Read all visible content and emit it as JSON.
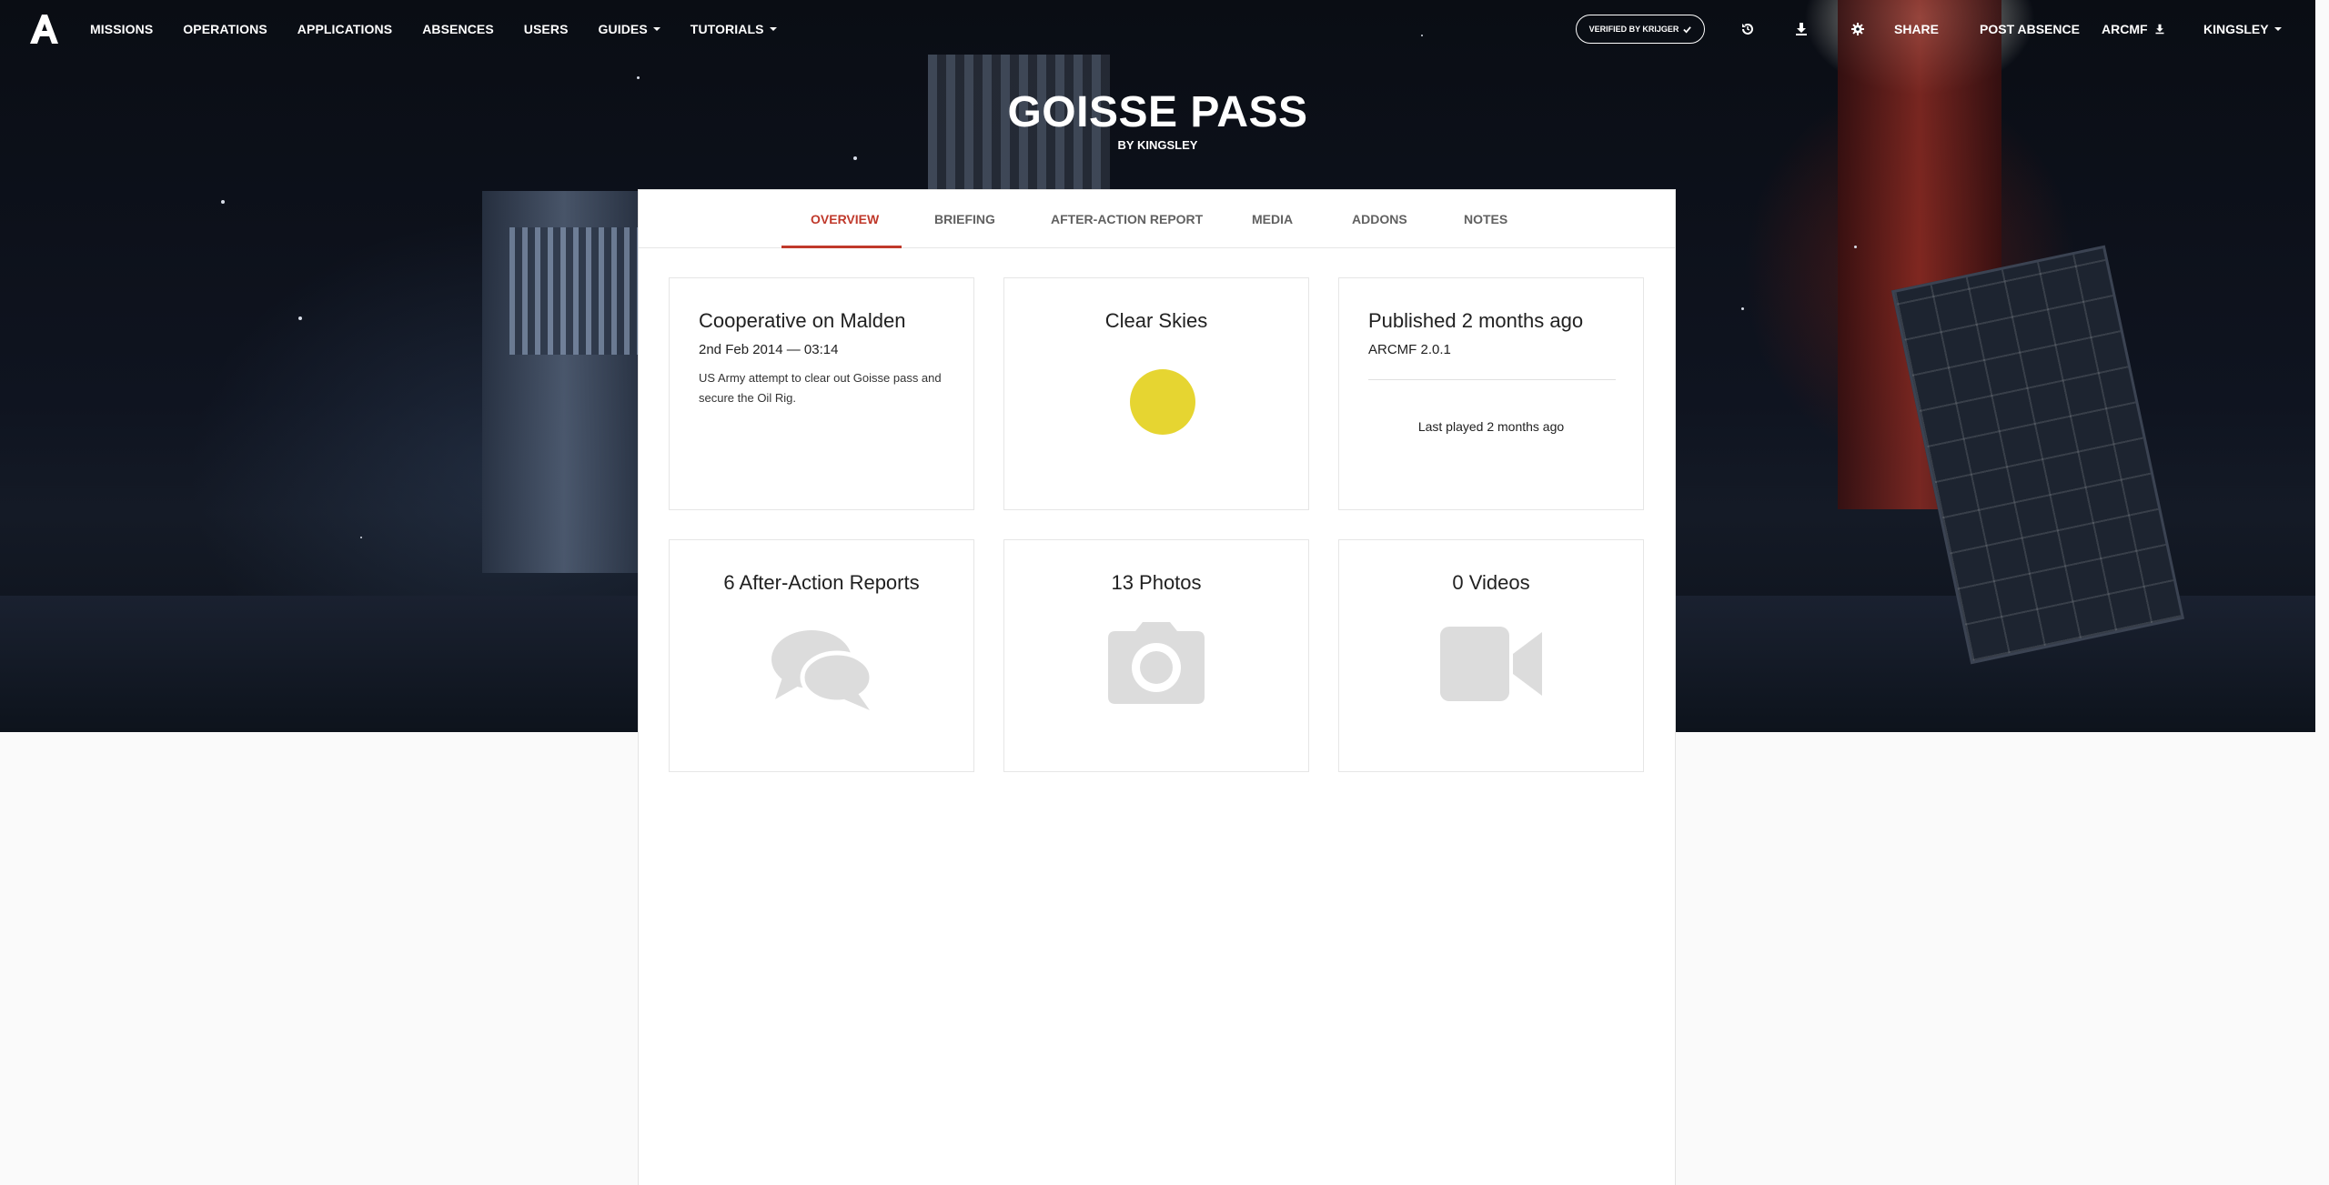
{
  "nav": {
    "links": [
      {
        "label": "MISSIONS"
      },
      {
        "label": "OPERATIONS"
      },
      {
        "label": "APPLICATIONS"
      },
      {
        "label": "ABSENCES"
      },
      {
        "label": "USERS"
      },
      {
        "label": "GUIDES",
        "dropdown": true
      },
      {
        "label": "TUTORIALS",
        "dropdown": true
      }
    ],
    "verified_badge": "VERIFIED BY KRIJGER",
    "share": "SHARE",
    "post_absence": "POST ABSENCE",
    "arcmf": "ARCMF",
    "user": "KINGSLEY"
  },
  "mission": {
    "title": "GOISSE PASS",
    "byline": "BY KINGSLEY"
  },
  "tabs": [
    "OVERVIEW",
    "BRIEFING",
    "AFTER-ACTION REPORT",
    "MEDIA",
    "ADDONS",
    "NOTES"
  ],
  "active_tab": "OVERVIEW",
  "overview": {
    "mode_map": "Cooperative on Malden",
    "datetime": "2nd Feb 2014 — 03:14",
    "description": "US Army attempt to clear out Goisse pass and secure the Oil Rig.",
    "weather": "Clear Skies",
    "weather_color": "#e6d531",
    "published": "Published 2 months ago",
    "framework": "ARCMF 2.0.1",
    "last_played": "Last played 2 months ago",
    "aar": "6 After-Action Reports",
    "photos": "13 Photos",
    "videos": "0 Videos"
  },
  "colors": {
    "accent": "#c0392b",
    "icon_grey": "#dcdcdc"
  }
}
